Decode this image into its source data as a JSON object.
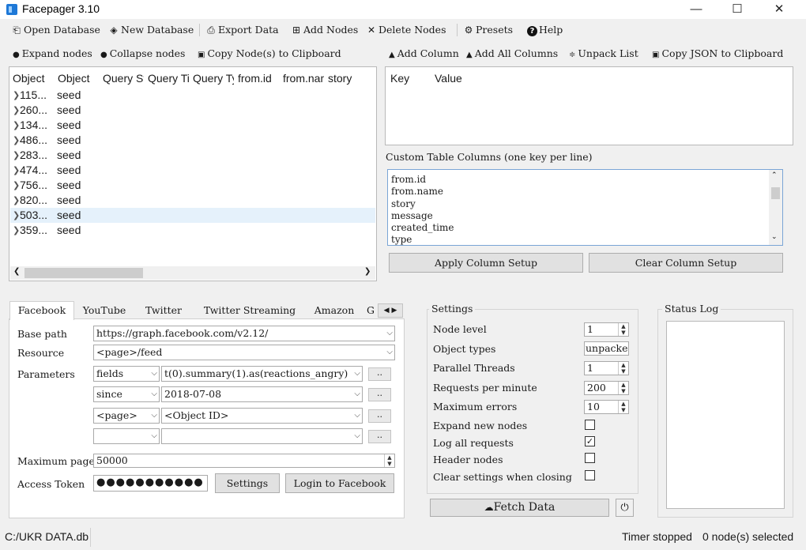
{
  "window": {
    "title": "Facepager 3.10",
    "minimize": "—",
    "maximize": "☐",
    "close": "✕"
  },
  "toolbar": {
    "open_database": "Open Database",
    "new_database": "New Database",
    "export_data": "Export Data",
    "add_nodes": "Add Nodes",
    "delete_nodes": "Delete Nodes",
    "presets": "Presets",
    "help": "Help"
  },
  "tree_tools": {
    "expand": "Expand nodes",
    "collapse": "Collapse nodes",
    "copy": "Copy Node(s) to Clipboard"
  },
  "data_tools": {
    "add_column": "Add Column",
    "add_all_columns": "Add All Columns",
    "unpack_list": "Unpack List",
    "copy_json": "Copy JSON to Clipboard"
  },
  "tree": {
    "columns": [
      "Object",
      "Object",
      "Query Status",
      "Query Time",
      "Query Type",
      "from.id",
      "from.name",
      "story"
    ],
    "rows": [
      {
        "id": "115...",
        "type": "seed"
      },
      {
        "id": "260...",
        "type": "seed"
      },
      {
        "id": "134...",
        "type": "seed"
      },
      {
        "id": "486...",
        "type": "seed"
      },
      {
        "id": "283...",
        "type": "seed"
      },
      {
        "id": "474...",
        "type": "seed"
      },
      {
        "id": "756...",
        "type": "seed"
      },
      {
        "id": "820...",
        "type": "seed"
      },
      {
        "id": "503...",
        "type": "seed"
      },
      {
        "id": "359...",
        "type": "seed"
      }
    ],
    "selected_row": 8
  },
  "detail": {
    "key_header": "Key",
    "value_header": "Value"
  },
  "custom_columns": {
    "label": "Custom Table Columns (one key per line)",
    "lines": [
      "from.id",
      "from.name",
      "story",
      "message",
      "created_time",
      "type"
    ],
    "apply": "Apply Column Setup",
    "clear": "Clear Column Setup"
  },
  "tabs": [
    "Facebook",
    "YouTube",
    "Twitter",
    "Twitter Streaming",
    "Amazon",
    "G"
  ],
  "facebook": {
    "base_path_label": "Base path",
    "base_path": "https://graph.facebook.com/v2.12/",
    "resource_label": "Resource",
    "resource": "<page>/feed",
    "parameters_label": "Parameters",
    "params": [
      {
        "name": "fields",
        "value": "t(0).summary(1).as(reactions_angry)"
      },
      {
        "name": "since",
        "value": "2018-07-08"
      },
      {
        "name": "<page>",
        "value": "<Object ID>"
      },
      {
        "name": "",
        "value": ""
      }
    ],
    "dots": "..",
    "max_pages_label": "Maximum pages",
    "max_pages": "50000",
    "token_label": "Access Token",
    "token_mask": "●●●●●●●●●●●",
    "settings_btn": "Settings",
    "login_btn": "Login to Facebook"
  },
  "settings": {
    "title": "Settings",
    "node_level_label": "Node level",
    "node_level": "1",
    "object_types_label": "Object types",
    "object_types": "unpacked",
    "threads_label": "Parallel Threads",
    "threads": "1",
    "rpm_label": "Requests per minute",
    "rpm": "200",
    "max_errors_label": "Maximum errors",
    "max_errors": "10",
    "expand_label": "Expand new nodes",
    "expand_checked": false,
    "log_label": "Log all requests",
    "log_checked": true,
    "header_label": "Header nodes",
    "header_checked": false,
    "clear_label": "Clear settings when closing",
    "clear_checked": false,
    "fetch": "Fetch Data"
  },
  "status_log": {
    "title": "Status Log"
  },
  "statusbar": {
    "db": "C:/UKR DATA.db",
    "timer": "Timer stopped",
    "selection": "0 node(s) selected"
  }
}
